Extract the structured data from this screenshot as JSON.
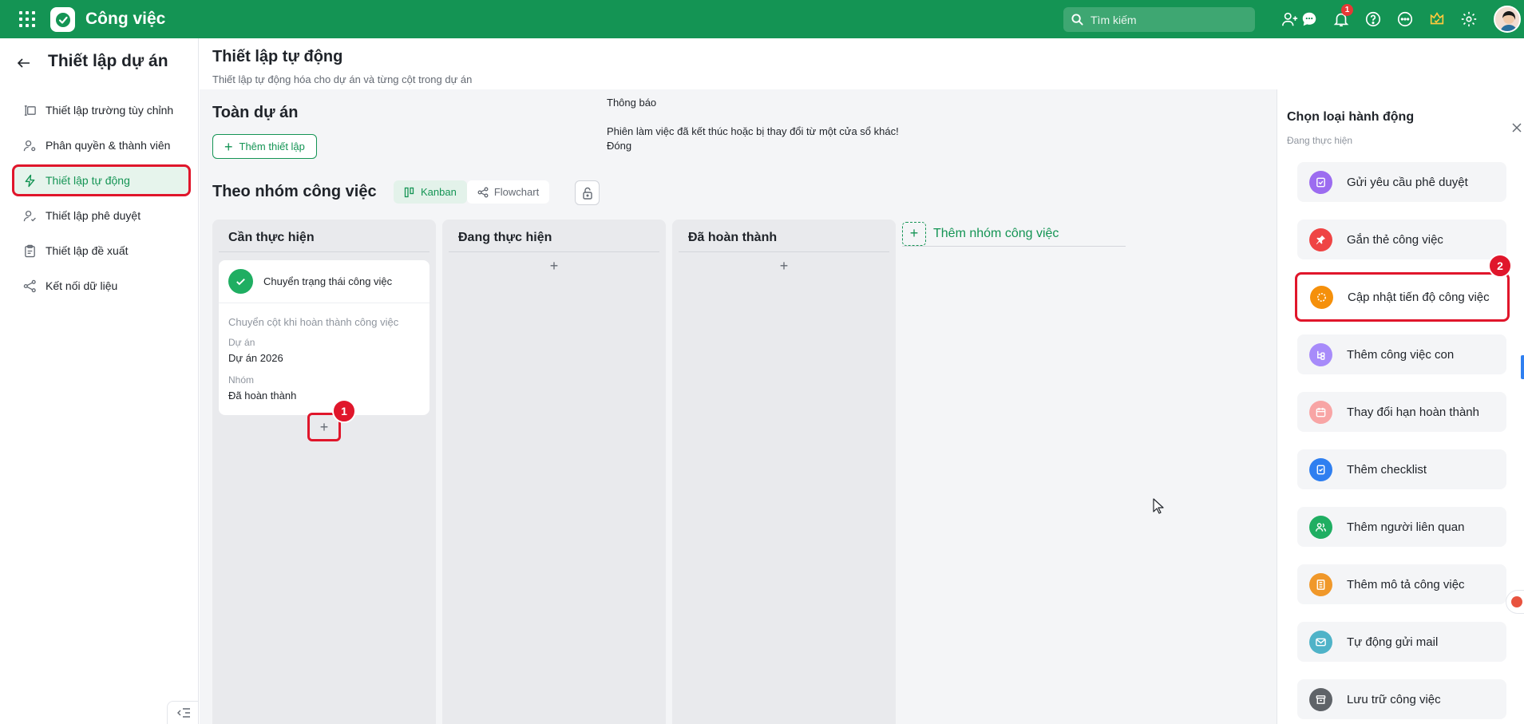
{
  "topbar": {
    "app_title": "Công việc",
    "search_placeholder": "Tìm kiếm",
    "notification_count": "1",
    "brand_color": "#149454"
  },
  "sidebar": {
    "title": "Thiết lập dự án",
    "items": [
      {
        "label": "Thiết lập trường tùy chỉnh",
        "icon": "custom-field-icon"
      },
      {
        "label": "Phân quyền & thành viên",
        "icon": "user-settings-icon"
      },
      {
        "label": "Thiết lập tự động",
        "icon": "lightning-icon",
        "active": true
      },
      {
        "label": "Thiết lập phê duyệt",
        "icon": "user-check-icon"
      },
      {
        "label": "Thiết lập đề xuất",
        "icon": "clipboard-icon"
      },
      {
        "label": "Kết nối dữ liệu",
        "icon": "connect-icon"
      }
    ]
  },
  "header": {
    "title": "Thiết lập tự động",
    "subtitle": "Thiết lập tự động hóa cho dự án và từng cột trong dự án"
  },
  "project_section": {
    "title": "Toàn dự án",
    "add_button": "Thêm thiết lập"
  },
  "notice": {
    "heading": "Thông báo",
    "message": "Phiên làm việc đã kết thúc hoặc bị thay đổi từ một cửa sổ khác!",
    "close": "Đóng"
  },
  "group_section": {
    "title": "Theo nhóm công việc",
    "tabs": [
      {
        "label": "Kanban",
        "active": true
      },
      {
        "label": "Flowchart",
        "active": false
      }
    ],
    "add_group": "Thêm nhóm công việc",
    "columns": [
      {
        "title": "Cần thực hiện"
      },
      {
        "title": "Đang thực hiện"
      },
      {
        "title": "Đã hoàn thành"
      }
    ],
    "card": {
      "name": "Chuyển trạng thái công việc",
      "description": "Chuyển cột khi hoàn thành công việc",
      "project_label": "Dự án",
      "project_value": "Dự án 2026",
      "group_label": "Nhóm",
      "group_value": "Đã hoàn thành"
    }
  },
  "markers": {
    "m1": "1",
    "m2": "2"
  },
  "panel": {
    "title": "Chọn loại hành động",
    "subtitle": "Đang thực hiện",
    "actions": [
      {
        "label": "Gửi yêu cầu phê duyệt",
        "icon": "approval-icon",
        "color": "#9c6cf0"
      },
      {
        "label": "Gắn thẻ công việc",
        "icon": "pin-icon",
        "color": "#ef4444"
      },
      {
        "label": "Cập nhật tiến độ công việc",
        "icon": "progress-icon",
        "color": "#f5900b"
      },
      {
        "label": "Thêm công việc con",
        "icon": "subtask-icon",
        "color": "#a78bfa"
      },
      {
        "label": "Thay đổi hạn hoàn thành",
        "icon": "calendar-icon",
        "color": "#f8a5a5"
      },
      {
        "label": "Thêm checklist",
        "icon": "checklist-icon",
        "color": "#2f7ff0"
      },
      {
        "label": "Thêm người liên quan",
        "icon": "people-icon",
        "color": "#1fae62"
      },
      {
        "label": "Thêm mô tả công việc",
        "icon": "document-icon",
        "color": "#f0982a"
      },
      {
        "label": "Tự động gửi mail",
        "icon": "mail-icon",
        "color": "#4fb3c8"
      },
      {
        "label": "Lưu trữ công việc",
        "icon": "archive-icon",
        "color": "#5f6368"
      }
    ]
  }
}
